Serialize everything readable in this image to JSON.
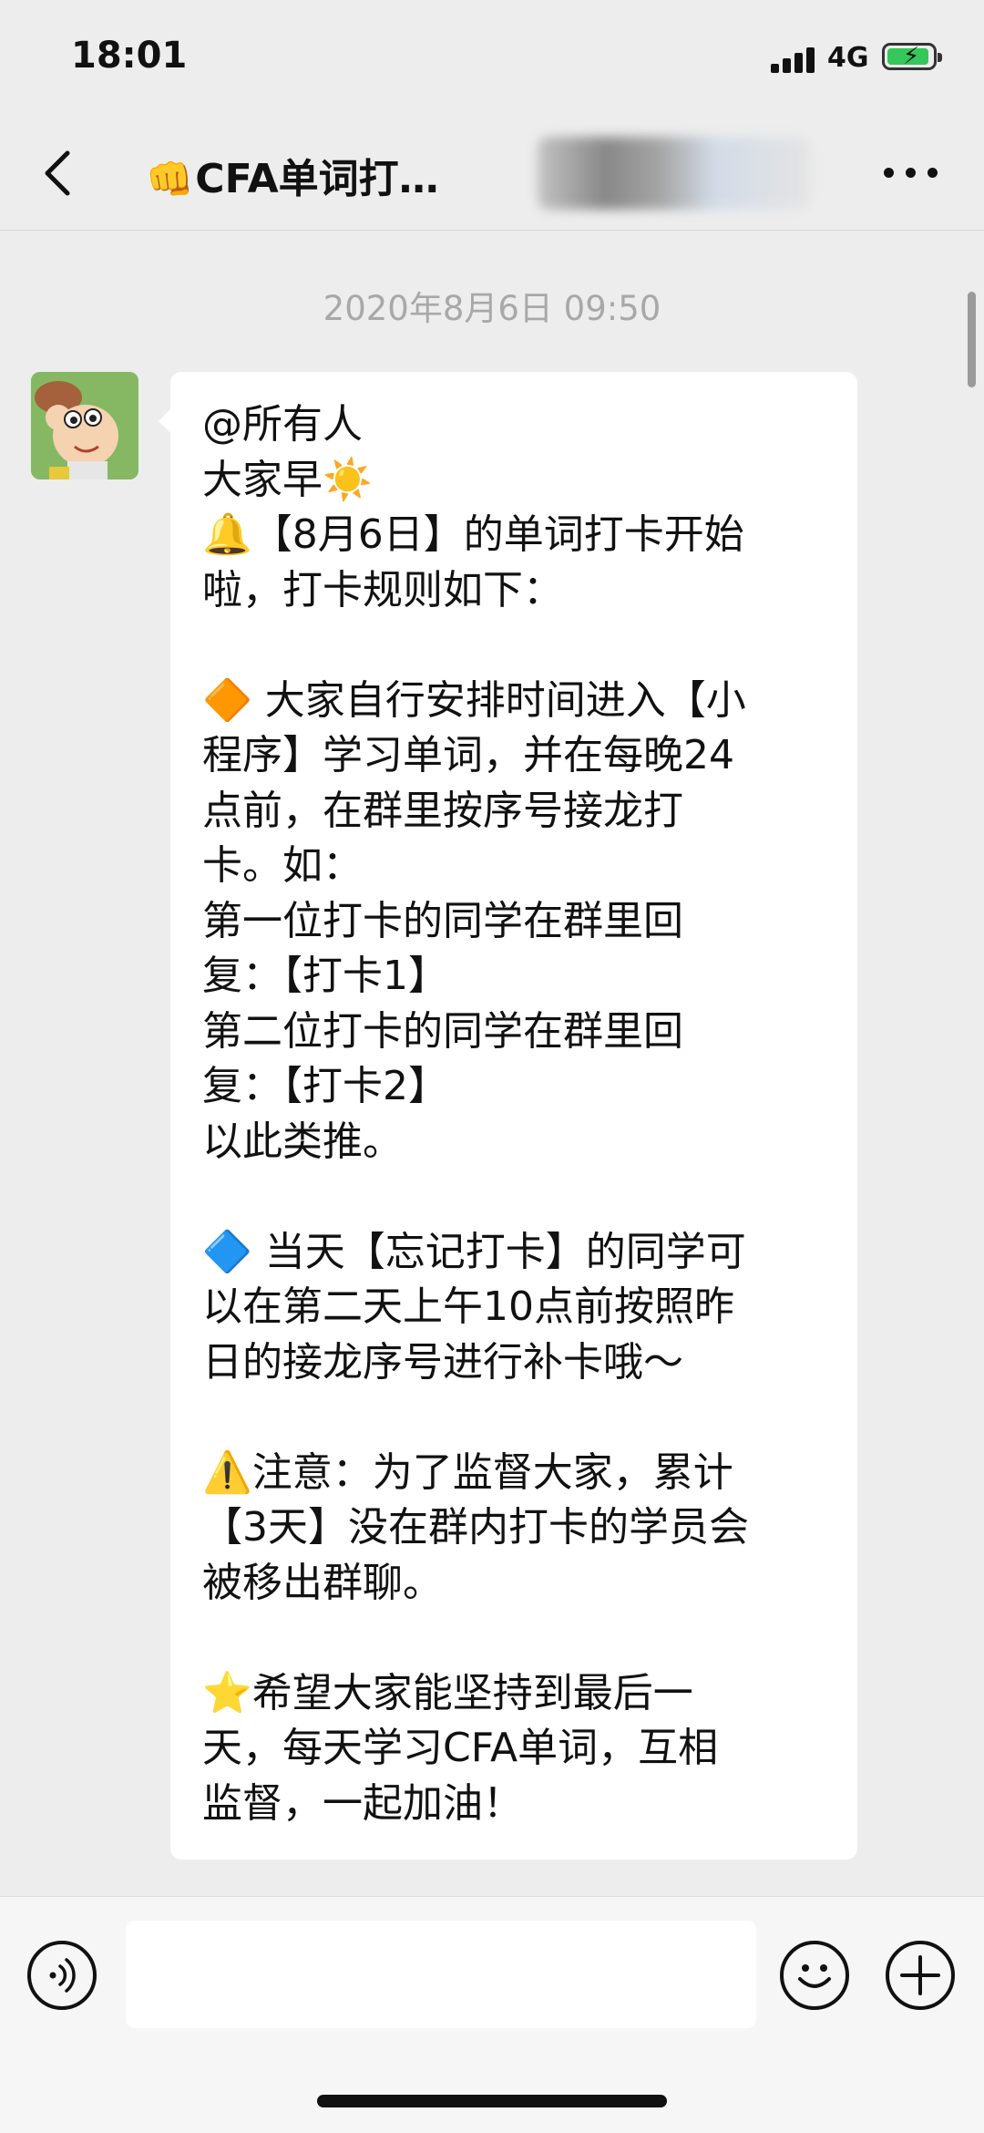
{
  "status_bar": {
    "time": "18:01",
    "network": "4G"
  },
  "nav": {
    "title": "CFA单词打…",
    "title_emoji": "👊",
    "back_icon": "chevron-left-icon",
    "more_icon": "more-dots-icon"
  },
  "chat": {
    "timestamp": "2020年8月6日 09:50",
    "message_lines": [
      "@所有人",
      "大家早☀️",
      "🔔【8月6日】的单词打卡开始",
      "啦，打卡规则如下：",
      "",
      "🔶 大家自行安排时间进入【小",
      "程序】学习单词，并在每晚24",
      "点前，在群里按序号接龙打",
      "卡。如：",
      "第一位打卡的同学在群里回",
      "复：【打卡1】",
      "第二位打卡的同学在群里回",
      "复：【打卡2】",
      "以此类推。",
      "",
      "🔷 当天【忘记打卡】的同学可",
      "以在第二天上午10点前按照昨",
      "日的接龙序号进行补卡哦～",
      "",
      "⚠️注意：为了监督大家，累计",
      "【3天】没在群内打卡的学员会",
      "被移出群聊。",
      "",
      "⭐希望大家能坚持到最后一",
      "天，每天学习CFA单词，互相",
      "监督，一起加油！"
    ]
  },
  "input_bar": {
    "voice_icon": "voice-icon",
    "emoji_icon": "emoji-icon",
    "plus_icon": "plus-icon",
    "input_value": ""
  },
  "colors": {
    "background": "#ededed",
    "bubble": "#ffffff",
    "battery_green": "#35c759"
  }
}
